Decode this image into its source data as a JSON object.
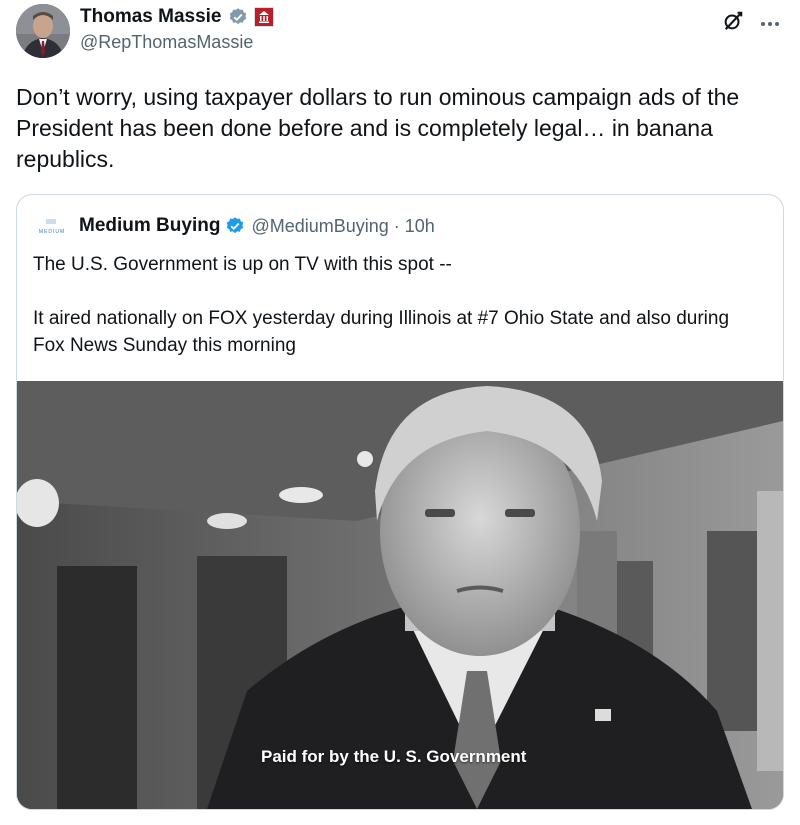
{
  "author": {
    "display_name": "Thomas Massie",
    "handle": "@RepThomasMassie",
    "verified_badge_color": "#829aab"
  },
  "tweet": {
    "text": "Don’t worry, using taxpayer dollars to run ominous campaign ads of the President has been done before and is completely legal… in banana republics."
  },
  "quoted": {
    "logo_text": "MEDIUM",
    "display_name": "Medium Buying",
    "handle_time": "@MediumBuying · 10h",
    "verified_badge_color": "#1d9bf0",
    "line1": "The U.S. Government is up on TV with this spot --",
    "line2": "It aired nationally on FOX yesterday during Illinois at #7 Ohio State and also during Fox News Sunday this morning",
    "video_caption": "Paid for by the U. S. Government"
  },
  "icons": {
    "grok": "grok-icon",
    "more": "more-icon",
    "verified": "verified-badge-icon",
    "gov": "government-badge-icon"
  }
}
